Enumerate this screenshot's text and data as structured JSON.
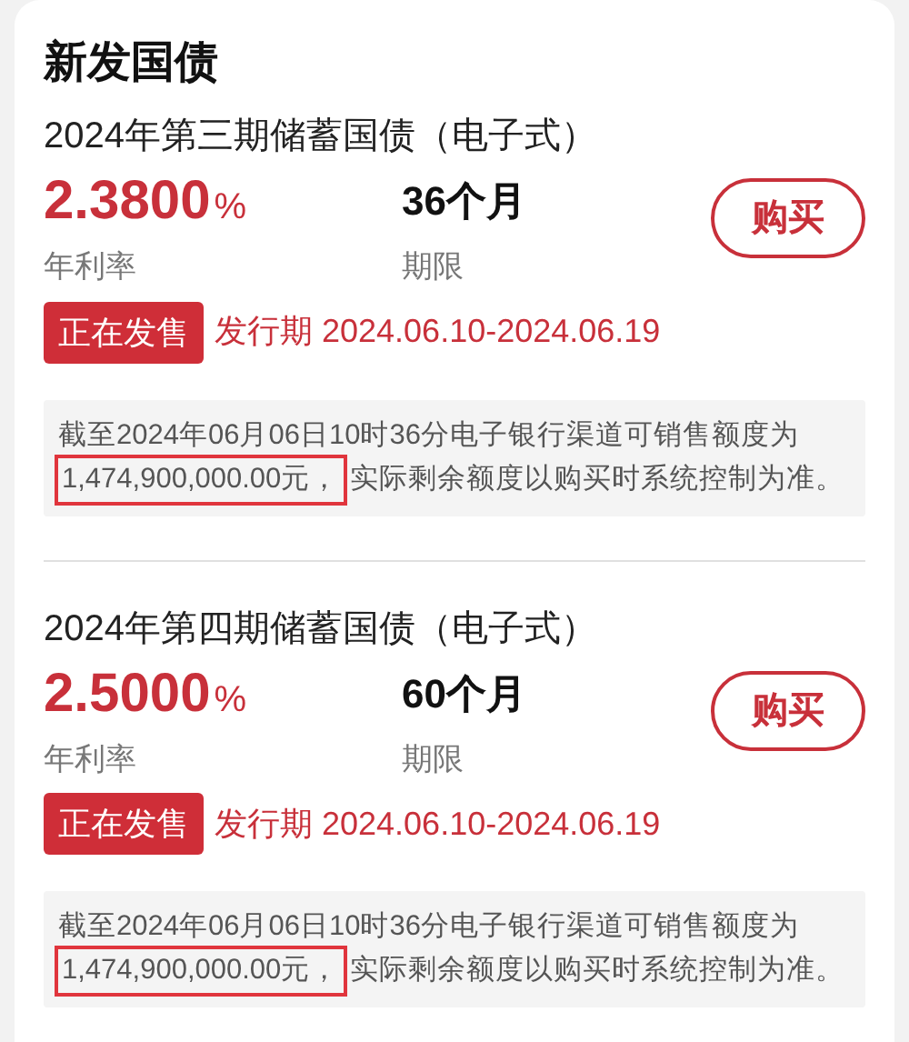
{
  "section_title": "新发国债",
  "bonds": [
    {
      "name": "2024年第三期储蓄国债（电子式）",
      "rate": "2.3800",
      "rate_unit": "%",
      "rate_label": "年利率",
      "term": "36个月",
      "term_label": "期限",
      "buy_button": "购买",
      "status": "正在发售",
      "issue_period": "发行期 2024.06.10-2024.06.19",
      "note_line": "截至2024年06月06日10时36分电子银行渠道可销售额度为",
      "note_amount": "1,474,900,000.00元，",
      "amount_highlighted": true,
      "note_rest": "实际剩余额度以购买时系统控制为准。"
    },
    {
      "name": "2024年第四期储蓄国债（电子式）",
      "rate": "2.5000",
      "rate_unit": "%",
      "rate_label": "年利率",
      "term": "60个月",
      "term_label": "期限",
      "buy_button": "购买",
      "status": "正在发售",
      "issue_period": "发行期 2024.06.10-2024.06.19",
      "note_line": "截至2024年06月06日10时36分电子银行渠道可销售额度为",
      "note_amount": "1,474,900,000.00元，",
      "amount_highlighted": true,
      "note_rest": "实际剩余额度以购买时系统控制为准。"
    }
  ]
}
